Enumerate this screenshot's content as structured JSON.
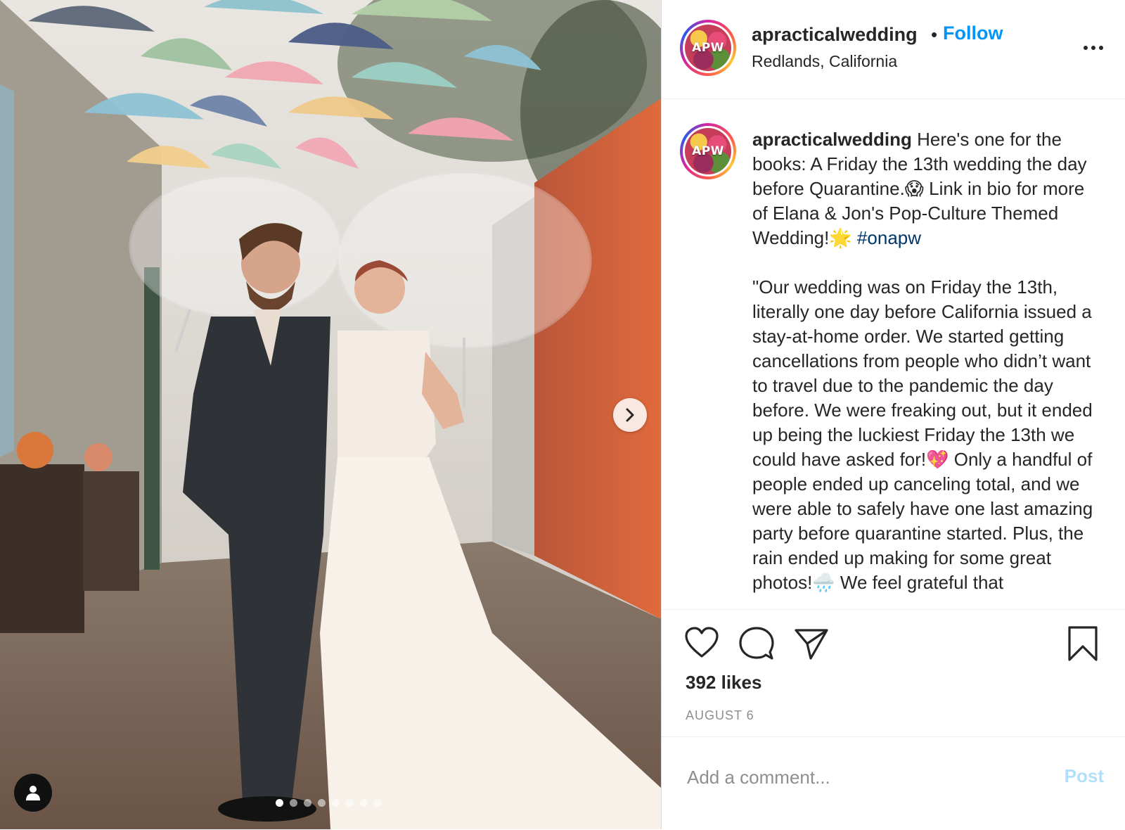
{
  "media": {
    "carousel_count": 8,
    "active_index": 0,
    "next_icon": "chevron-right-icon",
    "tag_icon": "user-tag-icon"
  },
  "header": {
    "avatar_text": "APW",
    "username": "apracticalwedding",
    "separator": "•",
    "follow_label": "Follow",
    "location": "Redlands, California",
    "more_icon": "more-options-icon"
  },
  "caption": {
    "avatar_text": "APW",
    "username": "apracticalwedding",
    "line1": "Here's one for the books: A Friday the 13th wedding the day before Quarantine.😱 Link in bio for more of Elana & Jon's Pop-Culture Themed Wedding!🌟 ",
    "hashtag": "#onapw",
    "paragraph2": "\"Our wedding was on Friday the 13th, literally one day before California issued a stay-at-home order. We started getting cancellations from people who didn’t want to travel due to the pandemic the day before. We were freaking out, but it ended up being the luckiest Friday the 13th we could have asked for!💖 Only a handful of people ended up canceling total, and we were able to safely have one last amazing party before quarantine started. Plus, the rain ended up making for some great photos!🌧️ We feel grateful that"
  },
  "actions": {
    "like_icon": "heart-icon",
    "comment_icon": "comment-icon",
    "share_icon": "send-icon",
    "save_icon": "bookmark-icon",
    "likes": "392 likes",
    "date": "AUGUST 6"
  },
  "comment": {
    "placeholder": "Add a comment...",
    "post_label": "Post"
  },
  "colors": {
    "accent": "#0095f6",
    "hashtag": "#00376b",
    "post_disabled": "#b2dffc",
    "muted": "#8e8e8e"
  }
}
